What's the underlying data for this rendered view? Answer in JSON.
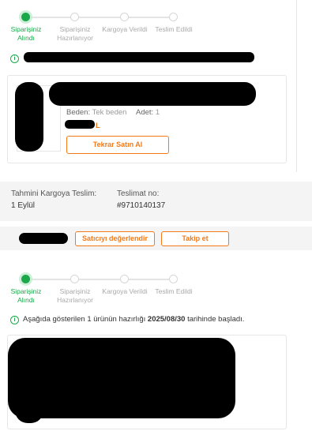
{
  "order_section_1": {
    "steps": [
      {
        "label": "Siparişiniz Alındı",
        "state": "active"
      },
      {
        "label": "Siparişiniz Hazırlanıyor",
        "state": "idle"
      },
      {
        "label": "Kargoya Verildi",
        "state": "idle"
      },
      {
        "label": "Teslim Edildi",
        "state": "idle"
      }
    ],
    "info_icon": "info-circle-icon",
    "product": {
      "size_label": "Beden:",
      "size_value": "Tek beden",
      "qty_label": "Adet:",
      "qty_value": "1",
      "price_suffix": "L",
      "reorder_button": "Tekrar Satın Al"
    }
  },
  "shipping": {
    "estimate_label": "Tahmini Kargoya Teslim:",
    "estimate_value": "1 Eylül",
    "delivery_no_label": "Teslimat no:",
    "delivery_no_value": "#9710140137"
  },
  "seller_actions": {
    "rate_seller_button": "Satıcıyı değerlendir",
    "follow_button": "Takip et"
  },
  "order_section_2": {
    "steps": [
      {
        "label": "Siparişiniz Alındı",
        "state": "active"
      },
      {
        "label": "Siparişiniz Hazırlanıyor",
        "state": "idle"
      },
      {
        "label": "Kargoya Verildi",
        "state": "idle"
      },
      {
        "label": "Teslim Edildi",
        "state": "idle"
      }
    ],
    "info_icon": "info-circle-icon",
    "info_prefix": "Aşağıda gösterilen 1 ürünün hazırlığı ",
    "info_date": "2025/08/30",
    "info_suffix": " tarihinde başladı."
  },
  "colors": {
    "accent": "#f27a1a",
    "success": "#1aa84a",
    "band_bg": "#f4f4f4"
  }
}
